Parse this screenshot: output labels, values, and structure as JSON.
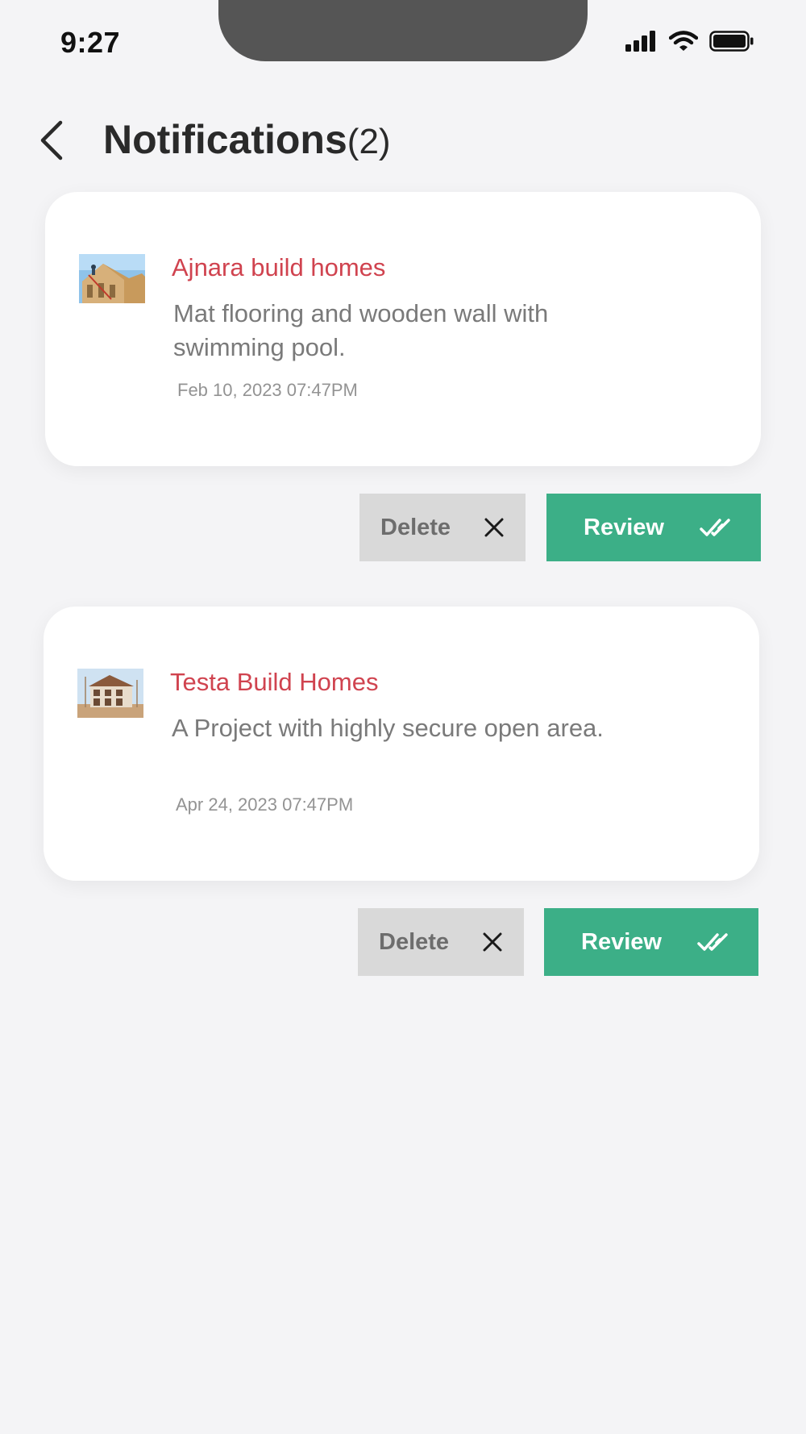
{
  "status_bar": {
    "time": "9:27"
  },
  "header": {
    "title": "Notifications",
    "count": "(2)"
  },
  "notifications": [
    {
      "title": "Ajnara build homes",
      "description": "Mat flooring and wooden wall with swimming pool.",
      "timestamp": "Feb 10, 2023 07:47PM",
      "delete_label": "Delete",
      "review_label": "Review"
    },
    {
      "title": "Testa Build Homes",
      "description": "A Project with highly secure open area.",
      "timestamp": "Apr 24, 2023 07:47PM",
      "delete_label": "Delete",
      "review_label": "Review"
    }
  ],
  "colors": {
    "accent_green": "#3caf87",
    "title_red": "#d0434f",
    "background": "#f4f4f6"
  },
  "icons": [
    "back-chevron-icon",
    "signal-icon",
    "wifi-icon",
    "battery-icon",
    "close-icon",
    "double-check-icon"
  ]
}
